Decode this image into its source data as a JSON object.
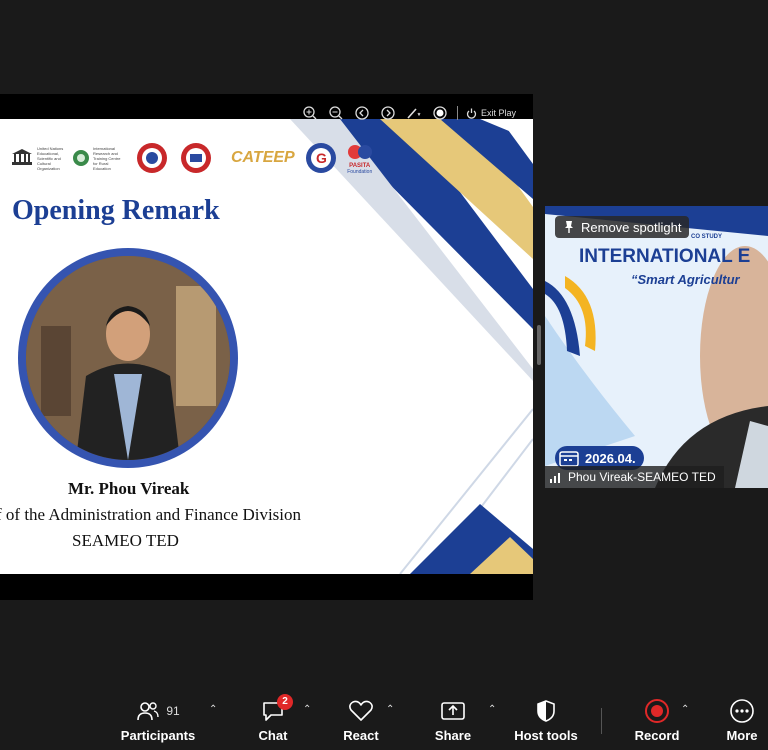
{
  "slide": {
    "toolbar": {
      "exit_label": "Exit Play"
    },
    "logos": {
      "unesco_text": "United Nations Educational, Scientific and Cultural Organization",
      "center_text": "International Research and Training Centre for Rural Education",
      "cateep": "CATEEP",
      "pasita": "PASITA",
      "pasita_sub": "Foundation"
    },
    "heading": "Opening Remark",
    "speaker_name": "Mr. Phou Vireak",
    "speaker_role": "f of the Administration and Finance Division",
    "speaker_org": "SEAMEO TED"
  },
  "video": {
    "spotlight_label": "Remove spotlight",
    "study_label": "CO STUDY",
    "title": "INTERNATIONAL E",
    "subtitle": "“Smart Agricultur",
    "date": "2026.04.",
    "participant_name": "Phou Vireak-SEAMEO TED"
  },
  "controls": {
    "participants": {
      "label": "Participants",
      "count": "91"
    },
    "chat": {
      "label": "Chat",
      "badge": "2"
    },
    "react": {
      "label": "React"
    },
    "share": {
      "label": "Share"
    },
    "host_tools": {
      "label": "Host tools"
    },
    "record": {
      "label": "Record"
    },
    "more": {
      "label": "More"
    }
  },
  "colors": {
    "slide_blue": "#1c3f94",
    "gold": "#e6c879",
    "record_red": "#e02828",
    "chat_badge": "#e02828"
  }
}
